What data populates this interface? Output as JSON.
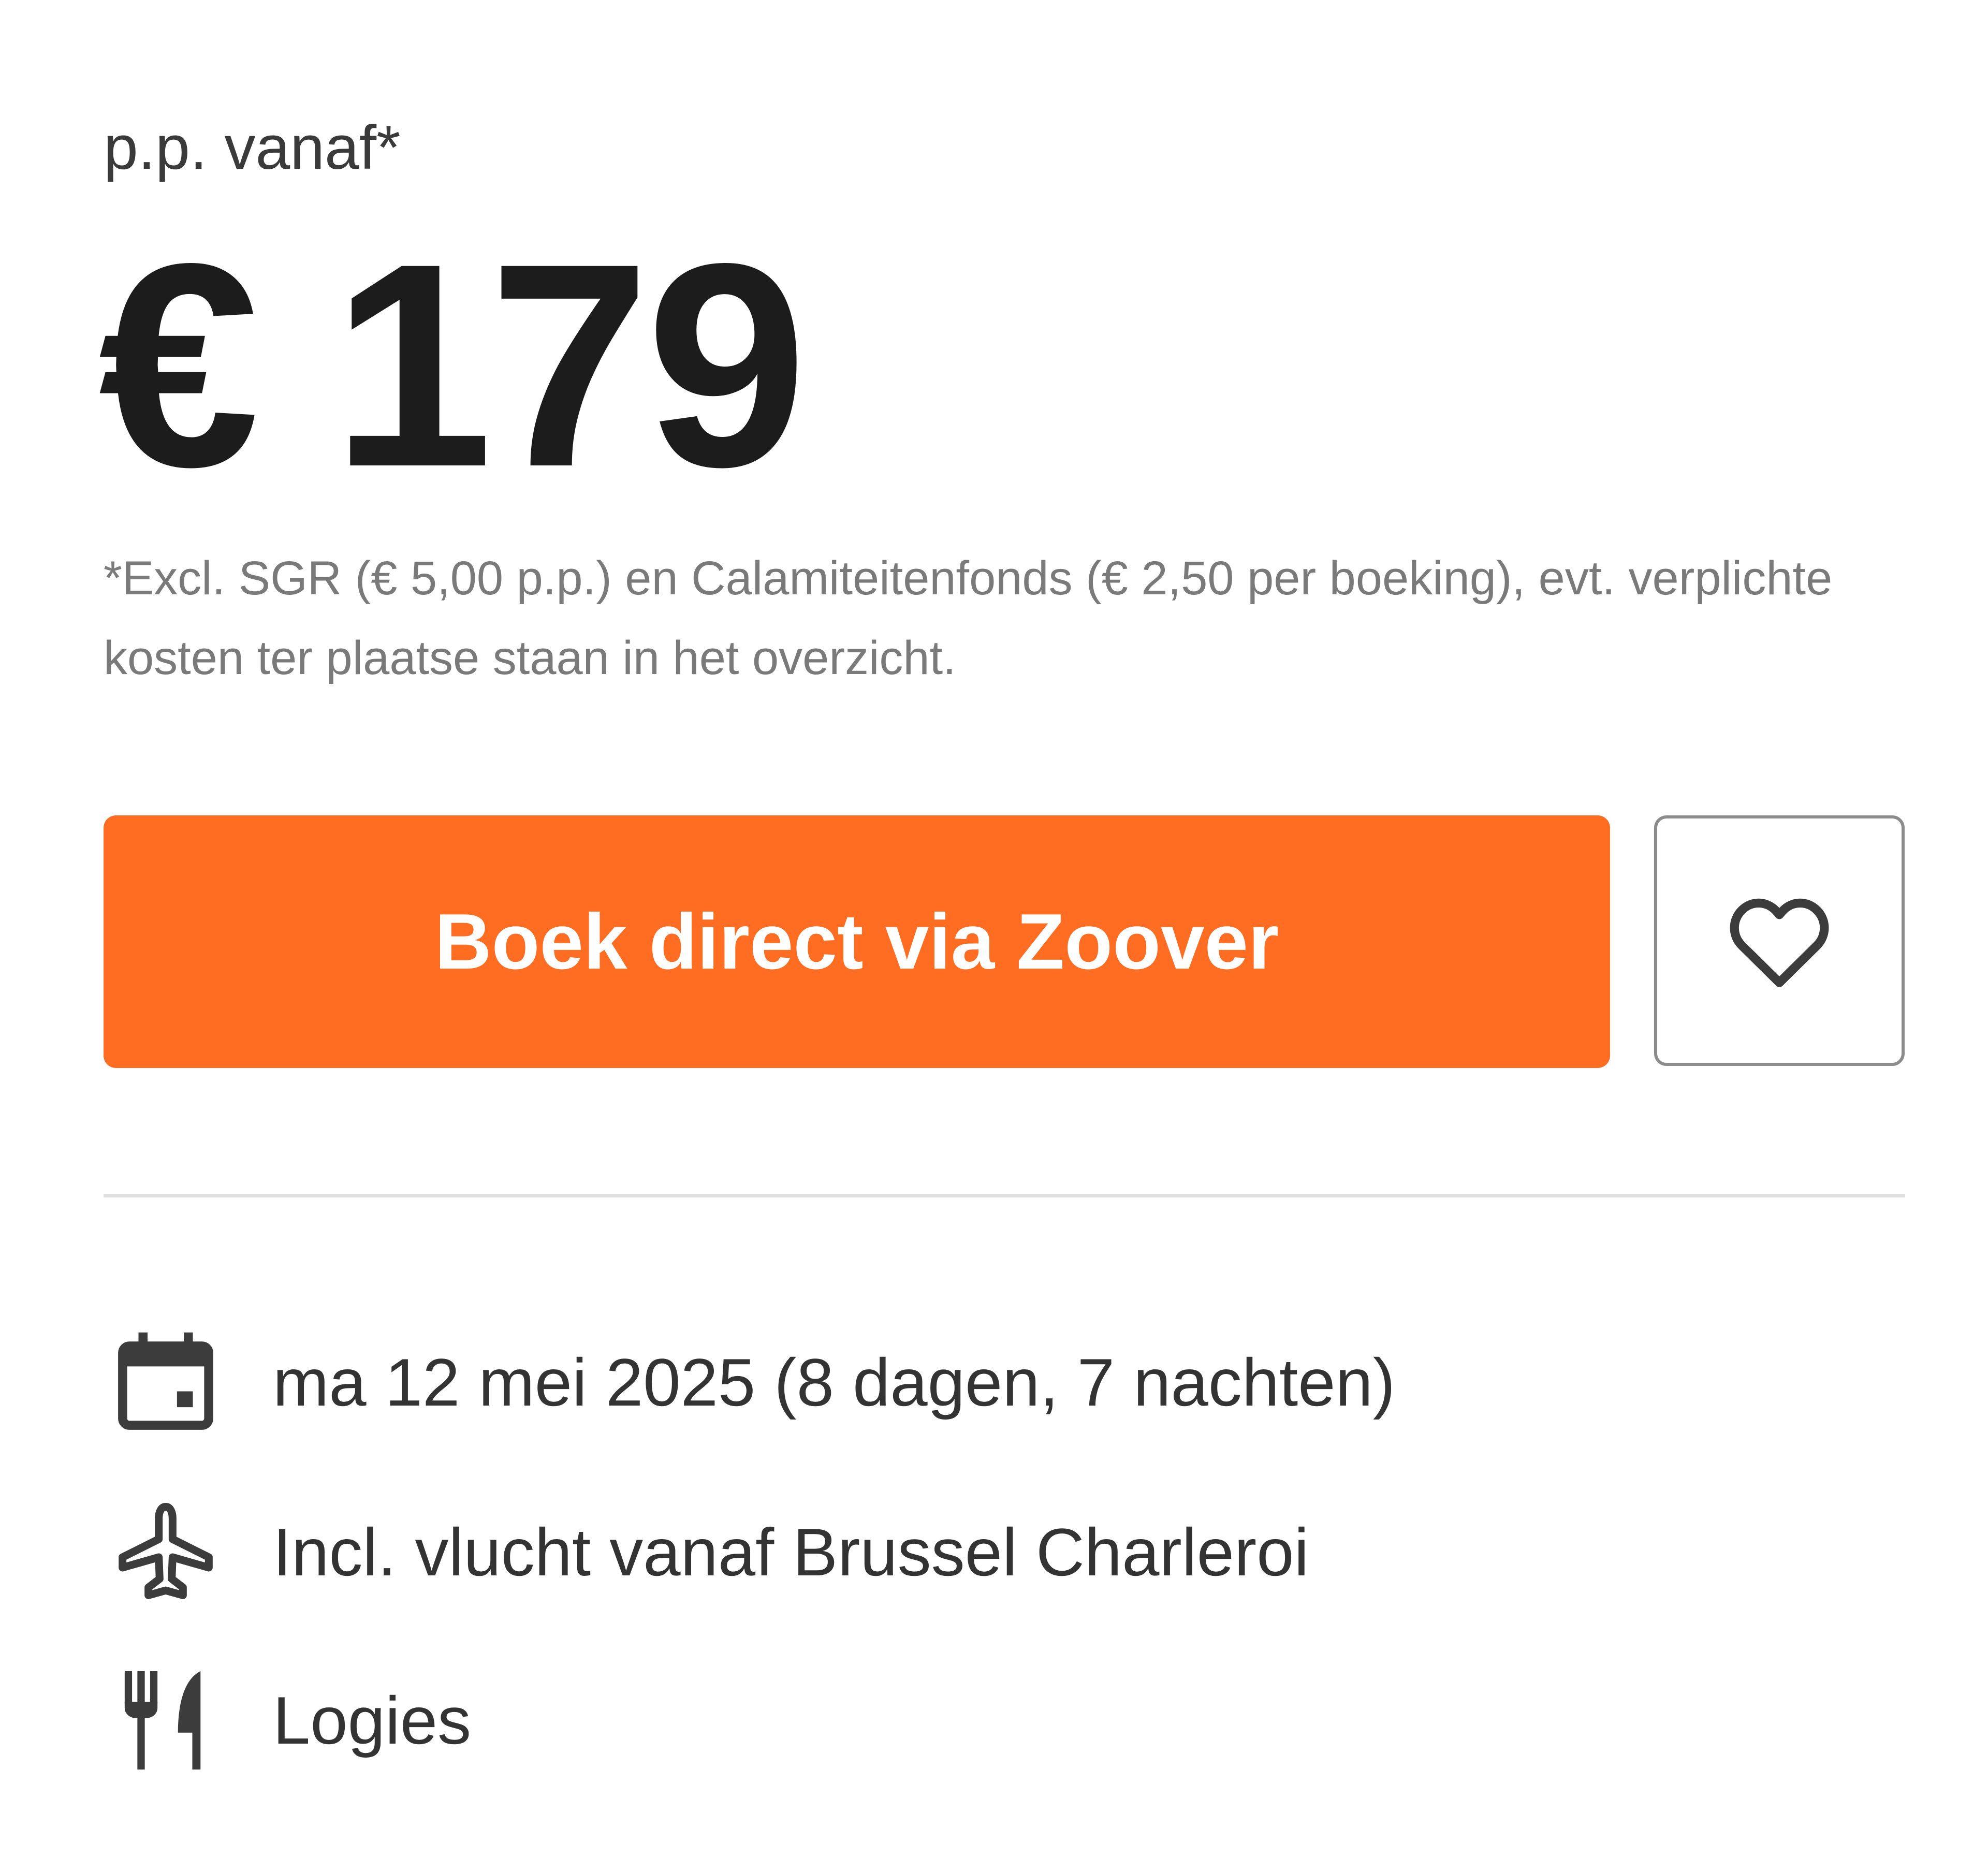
{
  "price_block": {
    "per_person_label": "p.p. vanaf*",
    "price": "€ 179",
    "disclaimer": "*Excl. SGR (€ 5,00 p.p.) en Calamiteitenfonds (€ 2,50 per boeking), evt. verplichte kosten ter plaatse staan in het overzicht."
  },
  "actions": {
    "book_label": "Boek direct via Zoover",
    "favorite_icon": "heart-icon"
  },
  "details": [
    {
      "icon": "calendar-icon",
      "text": "ma 12 mei 2025 (8 dagen, 7 nachten)"
    },
    {
      "icon": "airplane-icon",
      "text": "Incl. vlucht vanaf Brussel Charleroi"
    },
    {
      "icon": "fork-knife-icon",
      "text": "Logies"
    }
  ],
  "colors": {
    "accent": "#ff6d22",
    "text_dark": "#1c1c1c",
    "text_muted": "#7a7a7a",
    "divider": "#dedede"
  }
}
